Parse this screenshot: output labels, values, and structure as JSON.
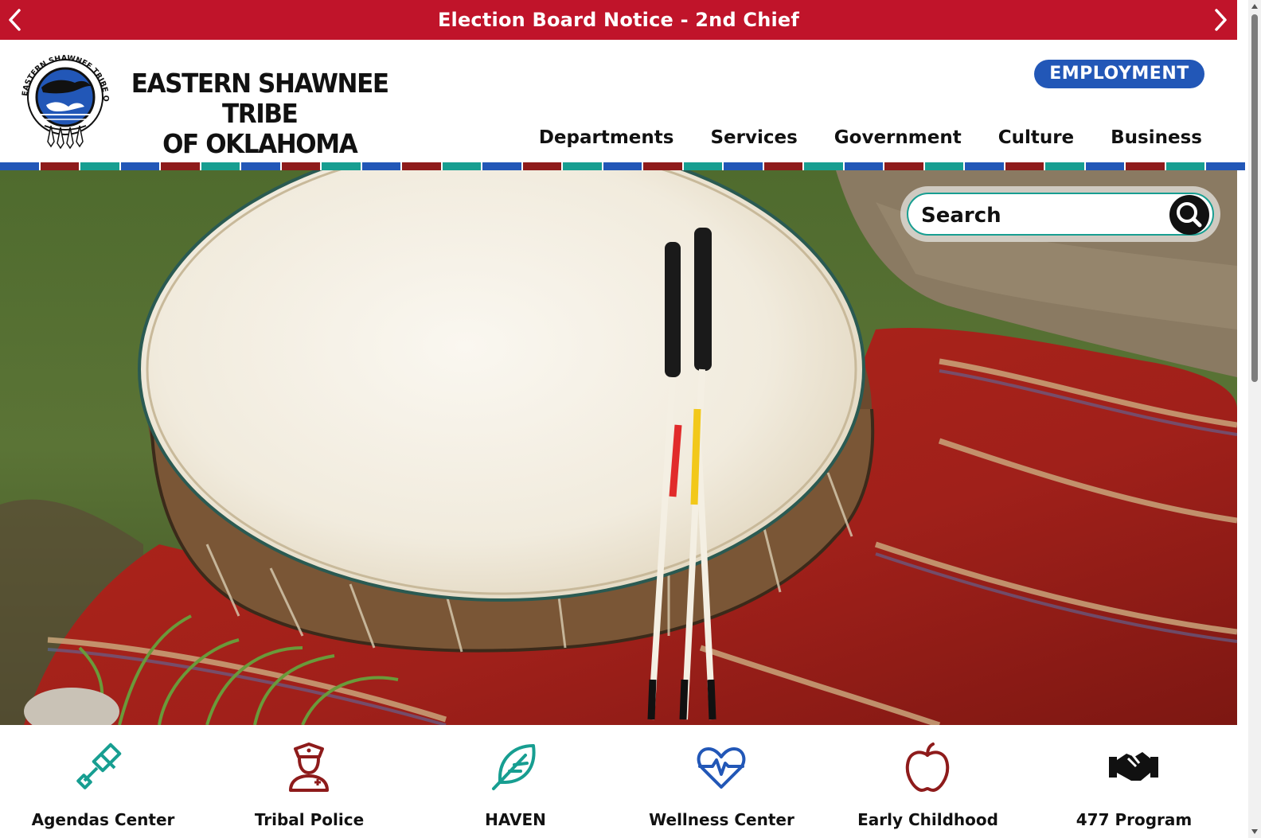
{
  "alert": {
    "text": "Election Board Notice - 2nd Chief",
    "prev_icon": "chevron-left-icon",
    "next_icon": "chevron-right-icon"
  },
  "logo": {
    "line1": "EASTERN SHAWNEE TRIBE",
    "line2": "OF OKLAHOMA",
    "seal_text": "EASTERN SHAWNEE TRIBE OF OKLAHOMA"
  },
  "header": {
    "employment_label": "EMPLOYMENT"
  },
  "nav": {
    "items": [
      {
        "label": "Departments"
      },
      {
        "label": "Services"
      },
      {
        "label": "Government"
      },
      {
        "label": "Culture"
      },
      {
        "label": "Business"
      }
    ]
  },
  "search": {
    "placeholder": "Search",
    "icon": "search-icon"
  },
  "quick_links": [
    {
      "label": "Agendas Center",
      "icon": "gavel-icon",
      "color": "#179e91"
    },
    {
      "label": "Tribal Police",
      "icon": "police-officer-icon",
      "color": "#8e1b1b"
    },
    {
      "label": "HAVEN",
      "icon": "feather-icon",
      "color": "#179e91"
    },
    {
      "label": "Wellness Center",
      "icon": "heartbeat-icon",
      "color": "#2257b7"
    },
    {
      "label": "Early Childhood",
      "icon": "apple-icon",
      "color": "#8e1b1b"
    },
    {
      "label": "477 Program",
      "icon": "handshake-icon",
      "color": "#111111"
    }
  ],
  "colors": {
    "alert_red": "#c0142a",
    "brand_blue": "#2257b7",
    "brand_maroon": "#8e1b1b",
    "brand_teal": "#179e91"
  }
}
